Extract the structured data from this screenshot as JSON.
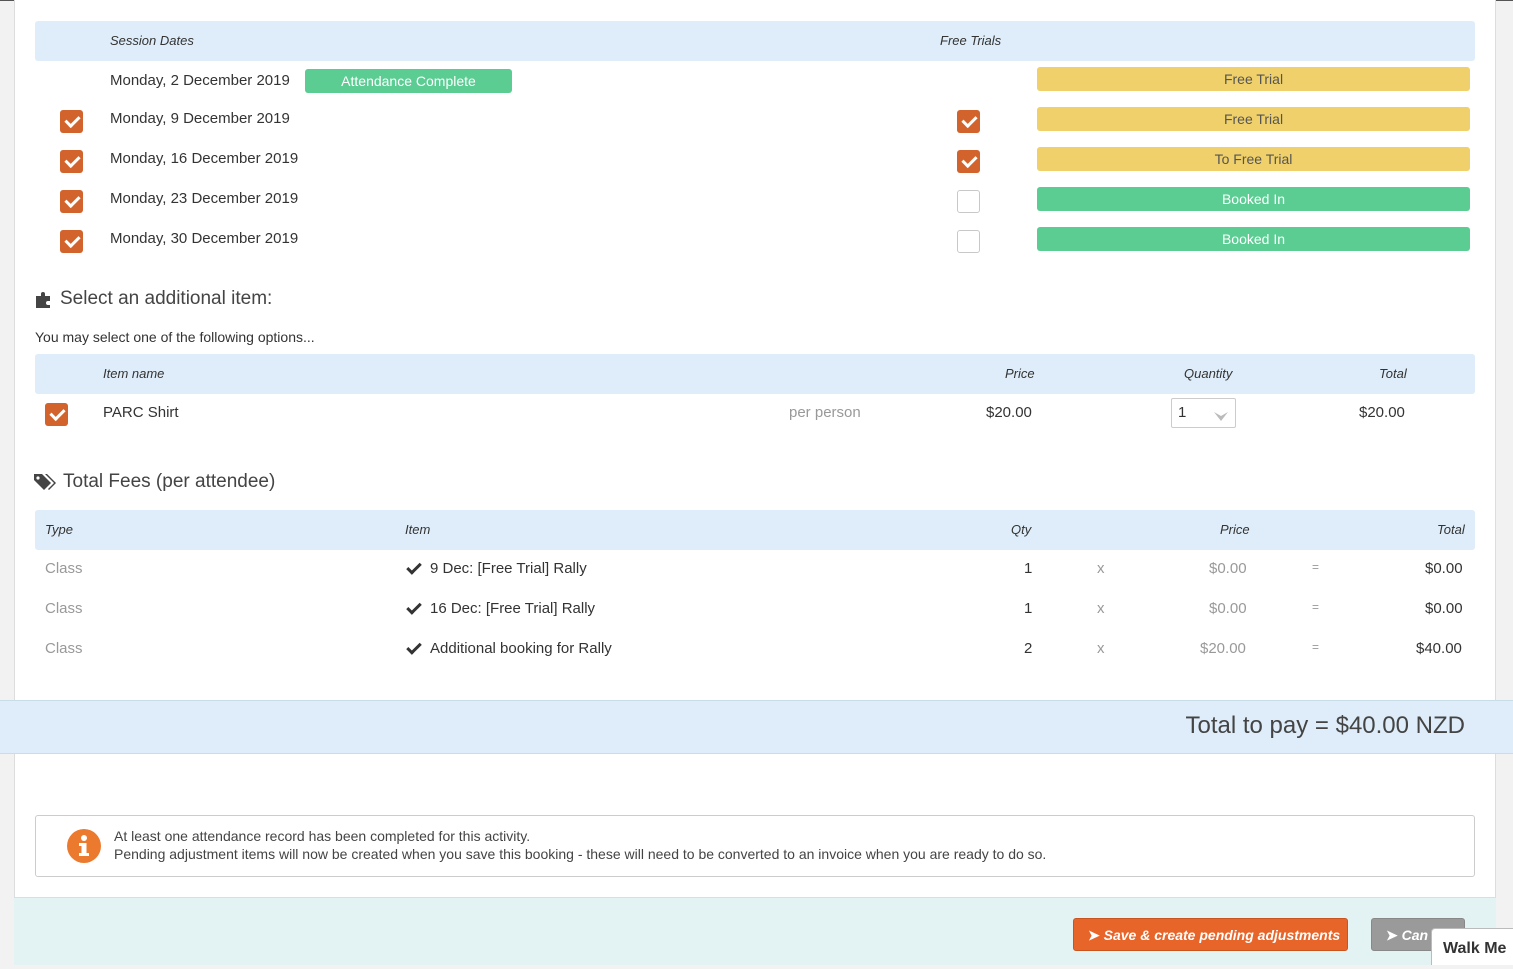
{
  "sessions": {
    "header_dates": "Session Dates",
    "header_trials": "Free Trials",
    "rows": [
      {
        "date": "Monday, 2 December 2019",
        "tag": "Attendance Complete",
        "status": "Free Trial"
      },
      {
        "date": "Monday, 9 December 2019",
        "status": "Free Trial"
      },
      {
        "date": "Monday, 16 December 2019",
        "status": "To Free Trial"
      },
      {
        "date": "Monday, 23 December 2019",
        "status": "Booked In"
      },
      {
        "date": "Monday, 30 December 2019",
        "status": "Booked In"
      }
    ]
  },
  "additional": {
    "title": "Select an additional item:",
    "subtitle": "You may select one of the following options...",
    "headers": {
      "item": "Item name",
      "price": "Price",
      "quantity": "Quantity",
      "total": "Total"
    },
    "row": {
      "name": "PARC Shirt",
      "unit": "per person",
      "price": "$20.00",
      "quantity": "1",
      "total": "$20.00"
    }
  },
  "fees": {
    "title": "Total Fees (per attendee)",
    "headers": {
      "type": "Type",
      "item": "Item",
      "qty": "Qty",
      "price": "Price",
      "total": "Total"
    },
    "rows": [
      {
        "type": "Class",
        "item": "9 Dec: [Free Trial] Rally",
        "qty": "1",
        "x": "x",
        "price": "$0.00",
        "eq": "=",
        "total": "$0.00"
      },
      {
        "type": "Class",
        "item": "16 Dec: [Free Trial] Rally",
        "qty": "1",
        "x": "x",
        "price": "$0.00",
        "eq": "=",
        "total": "$0.00"
      },
      {
        "type": "Class",
        "item": "Additional booking for Rally",
        "qty": "2",
        "x": "x",
        "price": "$20.00",
        "eq": "=",
        "total": "$40.00"
      }
    ]
  },
  "total_to_pay": "Total to pay = $40.00 NZD",
  "notice": {
    "line1": "At least one attendance record has been completed for this activity.",
    "line2": "Pending adjustment items will now be created when you save this booking - these will need to be converted to an invoice when you are ready to do so."
  },
  "buttons": {
    "save": "Save & create pending adjustments",
    "cancel": "Can"
  },
  "walkme": "Walk Me",
  "colors": {
    "accent": "#d2632c",
    "trial": "#efd06a",
    "booked": "#5bcc92",
    "header": "#deedf9",
    "save_button": "#e8652a"
  }
}
